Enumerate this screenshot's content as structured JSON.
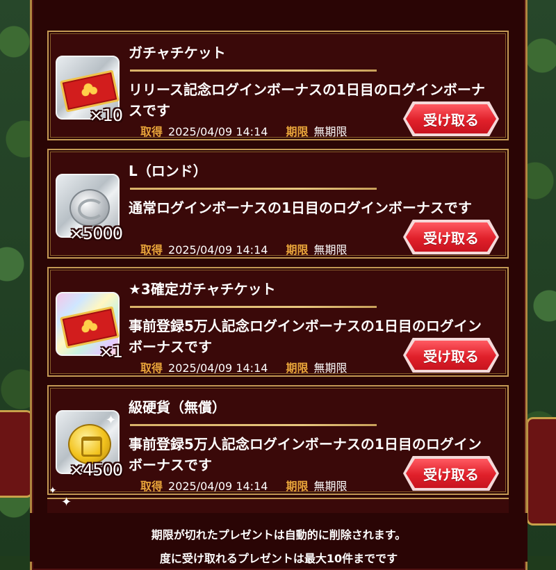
{
  "presents": [
    {
      "title": "ガチャチケット",
      "description": "リリース記念ログインボーナスの1日目のログインボーナスです",
      "quantity": "×10",
      "icon": "red-gacha-ticket-icon",
      "acquired_label": "取得",
      "acquired": "2025/04/09 14:14",
      "limit_label": "期限",
      "limit": "無期限",
      "button": "受け取る"
    },
    {
      "title": "L（ロンド）",
      "description": "通常ログインボーナスの1日目のログインボーナスです",
      "quantity": "×5000",
      "icon": "silver-coin-icon",
      "acquired_label": "取得",
      "acquired": "2025/04/09 14:14",
      "limit_label": "期限",
      "limit": "無期限",
      "button": "受け取る"
    },
    {
      "title": "★3確定ガチャチケット",
      "description": "事前登録5万人記念ログインボーナスの1日目のログインボーナスです",
      "quantity": "×1",
      "icon": "rainbow-gacha-ticket-icon",
      "acquired_label": "取得",
      "acquired": "2025/04/09 14:14",
      "limit_label": "期限",
      "limit": "無期限",
      "button": "受け取る"
    },
    {
      "title": "級硬貨（無償）",
      "description": "事前登録5万人記念ログインボーナスの1日目のログインボーナスです",
      "quantity": "×4500",
      "icon": "gold-coin-icon",
      "acquired_label": "取得",
      "acquired": "2025/04/09 14:14",
      "limit_label": "期限",
      "limit": "無期限",
      "button": "受け取る"
    }
  ],
  "footer": {
    "note1": "期限が切れたプレゼントは自動的に削除されます。",
    "note2": "度に受け取れるプレゼントは最大10件までです"
  }
}
